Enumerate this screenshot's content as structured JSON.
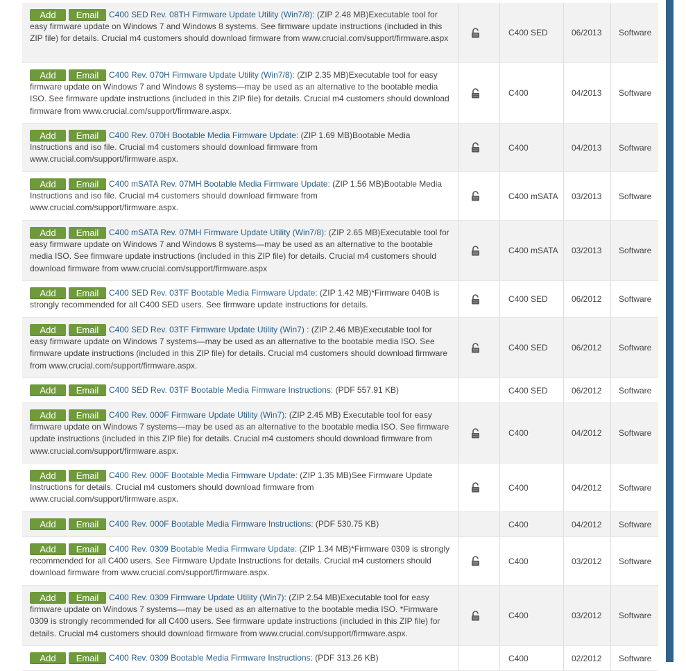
{
  "colors": {
    "button": "#6f9a3c",
    "link": "#2a5f86",
    "scrollbar": "#31638a"
  },
  "buttons": {
    "add": "Add",
    "email": "Email"
  },
  "rows": [
    {
      "title": "C400 SED Rev. 08TH Firmware Update Utility (Win7/8):",
      "desc": " (ZIP 2.48 MB)Executable tool for easy firmware update on Windows 7 and Windows 8 systems. See firmware update instructions (included in this ZIP file) for details. Crucial m4 customers should download firmware from www.crucial.com/support/firmware.aspx",
      "product": "C400 SED",
      "date": "06/2013",
      "type": "Software",
      "lock": true
    },
    {
      "title": "C400 Rev. 070H Firmware Update Utility (Win7/8):",
      "desc": " (ZIP 2.35 MB)Executable tool for easy firmware update on Windows 7 and Windows 8 systems—may be used as an alternative to the bootable media ISO. See firmware update instructions (included in this ZIP file) for details. Crucial m4 customers should download firmware from www.crucial.com/support/firmware.aspx.",
      "product": "C400",
      "date": "04/2013",
      "type": "Software",
      "lock": true
    },
    {
      "title": "C400 Rev. 070H Bootable Media Firmware Update:",
      "desc": " (ZIP 1.69 MB)Bootable Media Instructions and iso file. Crucial m4 customers should download firmware from www.crucial.com/support/firmware.aspx.",
      "product": "C400",
      "date": "04/2013",
      "type": "Software",
      "lock": true
    },
    {
      "title": "C400 mSATA Rev. 07MH Bootable Media Firmware Update:",
      "desc": " (ZIP 1.56 MB)Bootable Media Instructions and iso file. Crucial m4 customers should download firmware from www.crucial.com/support/firmware.aspx.",
      "product": "C400 mSATA",
      "date": "03/2013",
      "type": "Software",
      "lock": true
    },
    {
      "title": "C400 mSATA Rev. 07MH Firmware Update Utility (Win7/8):",
      "desc": " (ZIP 2.65 MB)Executable tool for easy firmware update on Windows 7 and Windows 8 systems—may be used as an alternative to the bootable media ISO. See firmware update instructions (included in this ZIP file) for details. Crucial m4 customers should download firmware from www.crucial.com/support/firmware.aspx",
      "product": "C400 mSATA",
      "date": "03/2013",
      "type": "Software",
      "lock": true
    },
    {
      "title": "C400 SED Rev. 03TF Bootable Media Firmware Update:",
      "desc": " (ZIP 1.42 MB)*Firmware 040B is strongly recommended for all C400 SED users. See firmware update instructions for details.",
      "product": "C400 SED",
      "date": "06/2012",
      "type": "Software",
      "lock": true
    },
    {
      "title": "C400 SED Rev. 03TF Firmware Update Utility (Win7) :",
      "desc": " (ZIP 2.46 MB)Executable tool for easy firmware update on Windows 7 systems—may be used as an alternative to the bootable media ISO. See firmware update instructions (included in this ZIP file) for details. Crucial m4 customers should download firmware from www.crucial.com/support/firmware.aspx.",
      "product": "C400 SED",
      "date": "06/2012",
      "type": "Software",
      "lock": true
    },
    {
      "title": "C400 SED Rev. 03TF Bootable Media Firmware Instructions:",
      "desc": " (PDF 557.91 KB)",
      "product": "C400 SED",
      "date": "06/2012",
      "type": "Software",
      "lock": false
    },
    {
      "title": "C400 Rev. 000F Firmware Update Utility (Win7):",
      "desc": " (ZIP 2.45 MB) Executable tool for easy firmware update on Windows 7 systems—may be used as an alternative to the bootable media ISO. See firmware update instructions (included in this ZIP file) for details. Crucial m4 customers should download firmware from www.crucial.com/support/firmware.aspx.",
      "product": "C400",
      "date": "04/2012",
      "type": "Software",
      "lock": true
    },
    {
      "title": "C400 Rev. 000F Bootable Media Firmware Update:",
      "desc": " (ZIP 1.35 MB)See Firmware Update Instructions for details. Crucial m4 customers should download firmware from www.crucial.com/support/firmware.aspx.",
      "product": "C400",
      "date": "04/2012",
      "type": "Software",
      "lock": true
    },
    {
      "title": "C400 Rev. 000F Bootable Media Firmware Instructions:",
      "desc": " (PDF 530.75 KB)",
      "product": "C400",
      "date": "04/2012",
      "type": "Software",
      "lock": false
    },
    {
      "title": "C400 Rev. 0309 Bootable Media Firmware Update:",
      "desc": " (ZIP 1.34 MB)*Firmware 0309 is strongly recommended for all C400 users. See Firmware Update Instructions for details. Crucial m4 customers should download firmware from www.crucial.com/support/firmware.aspx.",
      "product": "C400",
      "date": "03/2012",
      "type": "Software",
      "lock": true
    },
    {
      "title": "C400 Rev. 0309 Firmware Update Utility (Win7):",
      "desc": " (ZIP 2.54 MB)Executable tool for easy firmware update on Windows 7 systems—may be used as an alternative to the bootable media ISO. *Firmware 0309 is strongly recommended for all C400 users. See firmware update instructions (included in this ZIP file) for details. Crucial m4 customers should download firmware from www.crucial.com/support/firmware.aspx.",
      "product": "C400",
      "date": "03/2012",
      "type": "Software",
      "lock": true
    },
    {
      "title": "C400 Rev. 0309 Bootable Media Firmware Instructions:",
      "desc": " (PDF 313.26 KB)",
      "product": "C400",
      "date": "02/2012",
      "type": "Software",
      "lock": false
    }
  ]
}
